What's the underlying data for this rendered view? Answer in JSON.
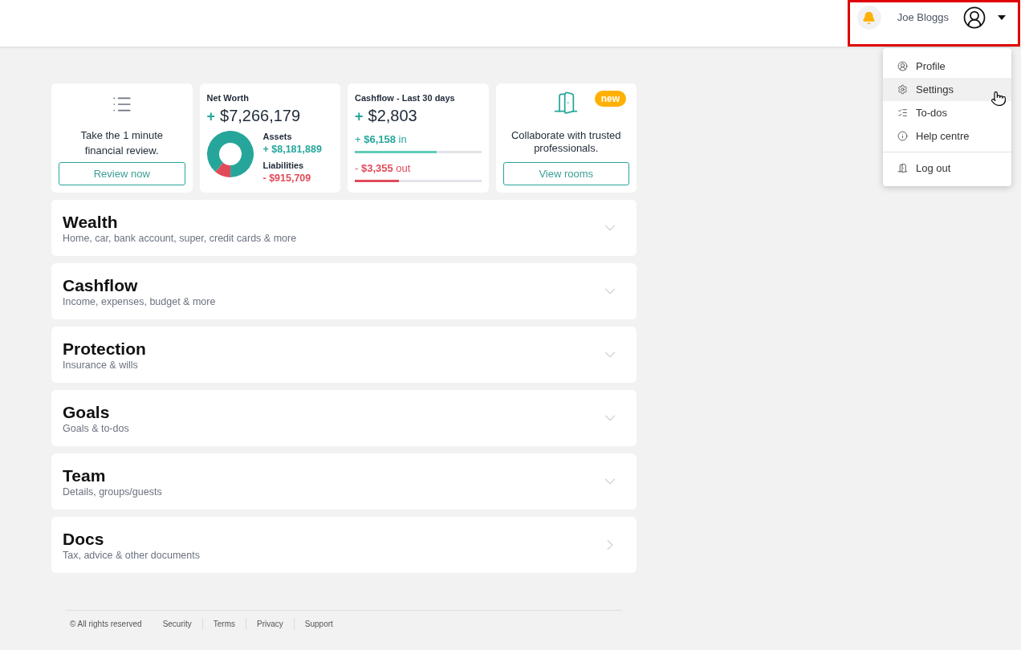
{
  "header": {
    "user_name": "Joe Bloggs"
  },
  "user_menu": {
    "expanded": true,
    "groups": [
      {
        "items": [
          {
            "label": "Profile",
            "selected": false
          },
          {
            "label": "Settings",
            "selected": true
          },
          {
            "label": "To-dos",
            "selected": false
          },
          {
            "label": "Help centre",
            "selected": false
          }
        ]
      },
      {
        "items": [
          {
            "label": "Log out",
            "selected": false
          }
        ]
      }
    ]
  },
  "cards": [
    {
      "kind": "prompt",
      "text": "Take the 1 minute financial review.",
      "button": "Review now"
    },
    {
      "kind": "net_worth",
      "title": "Net Worth",
      "sign": "+",
      "value": "$7,266,179",
      "legend_values": [
        "+ $8,181,889",
        "- $915,709"
      ],
      "chart_data": {
        "type": "donut",
        "categories": [
          "Assets",
          "Liabilities"
        ],
        "values": [
          88.8,
          11.2
        ]
      }
    },
    {
      "kind": "cashflow",
      "title": "Cashflow - Last 30 days",
      "sign": "+",
      "value": "$2,803",
      "flows": [
        {
          "kind": "in",
          "text": "+ **$6,158** in",
          "level": 0.65,
          "color": "#5fcbb9"
        },
        {
          "kind": "out",
          "text": "- **$3,355** out",
          "level": 0.35,
          "color": "#e04b5a"
        }
      ]
    },
    {
      "kind": "promo",
      "badge": "new",
      "text": "Collaborate with trusted professionals.",
      "button": "View rooms"
    }
  ],
  "sections": [
    {
      "kind": "expandable",
      "expanded": false,
      "title": "Wealth",
      "subtitle": "Home, car, bank account, super, credit cards & more"
    },
    {
      "kind": "expandable",
      "expanded": false,
      "title": "Cashflow",
      "subtitle": "Income, expenses, budget & more"
    },
    {
      "kind": "expandable",
      "expanded": false,
      "title": "Protection",
      "subtitle": "Insurance & wills"
    },
    {
      "kind": "expandable",
      "expanded": false,
      "title": "Goals",
      "subtitle": "Goals & to-dos"
    },
    {
      "kind": "expandable",
      "expanded": false,
      "title": "Team",
      "subtitle": "Details, groups/guests"
    },
    {
      "kind": "link",
      "title": "Docs",
      "subtitle": "Tax, advice & other documents"
    }
  ],
  "footer": {
    "copyright": "© All rights reserved",
    "links": [
      "Security",
      "Terms",
      "Privacy",
      "Support"
    ]
  }
}
